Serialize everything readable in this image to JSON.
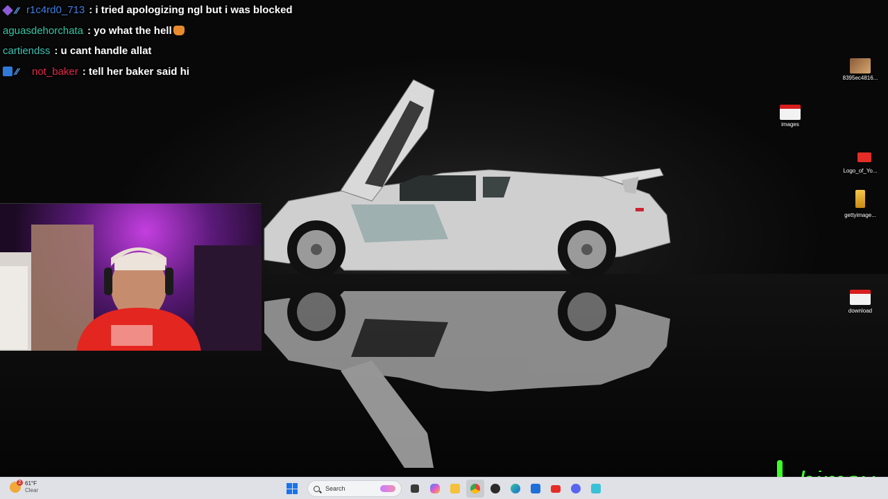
{
  "chat": {
    "messages": [
      {
        "badges": [
          "purple-gem-badge",
          "slash-badge"
        ],
        "user": "r1c4rd0_713",
        "user_color": "#3f7fe0",
        "text": "i tried apologizing ngl but i was blocked"
      },
      {
        "badges": [],
        "user": "aguasdehorchata",
        "user_color": "#35c8a8",
        "text": "yo what the hell",
        "emote": "cat-emote"
      },
      {
        "badges": [],
        "user": "cartiendss",
        "user_color": "#3ec2b4",
        "text": "u cant handle allat"
      },
      {
        "badges": [
          "prime-badge",
          "slash-badge"
        ],
        "user": "not_baker",
        "user_color": "#e0294a",
        "text": "tell her baker said hi"
      }
    ],
    "separator": ":"
  },
  "desktop_icons": [
    {
      "label": "8395ec4816...",
      "icon": "image-thumbnail-icon"
    },
    {
      "label": "images",
      "icon": "youtube-image-icon"
    },
    {
      "label": "Logo_of_Yo...",
      "icon": "youtube-logo-icon"
    },
    {
      "label": "gettyimage...",
      "icon": "image-thumbnail-icon"
    },
    {
      "label": "download",
      "icon": "youtube-image-icon"
    }
  ],
  "taskbar": {
    "weather": {
      "temp": "61°F",
      "condition": "Clear",
      "alert_count": "2"
    },
    "search_placeholder": "Search",
    "pinned_apps": [
      "windows-start-icon",
      "task-view-icon",
      "copilot-icon",
      "file-explorer-icon",
      "chrome-icon",
      "obs-icon",
      "edge-icon",
      "microsoft-store-icon",
      "youtube-icon",
      "discord-icon",
      "app-icon"
    ]
  },
  "streamer": {
    "name": "himay",
    "accent": "#3cff2a"
  }
}
